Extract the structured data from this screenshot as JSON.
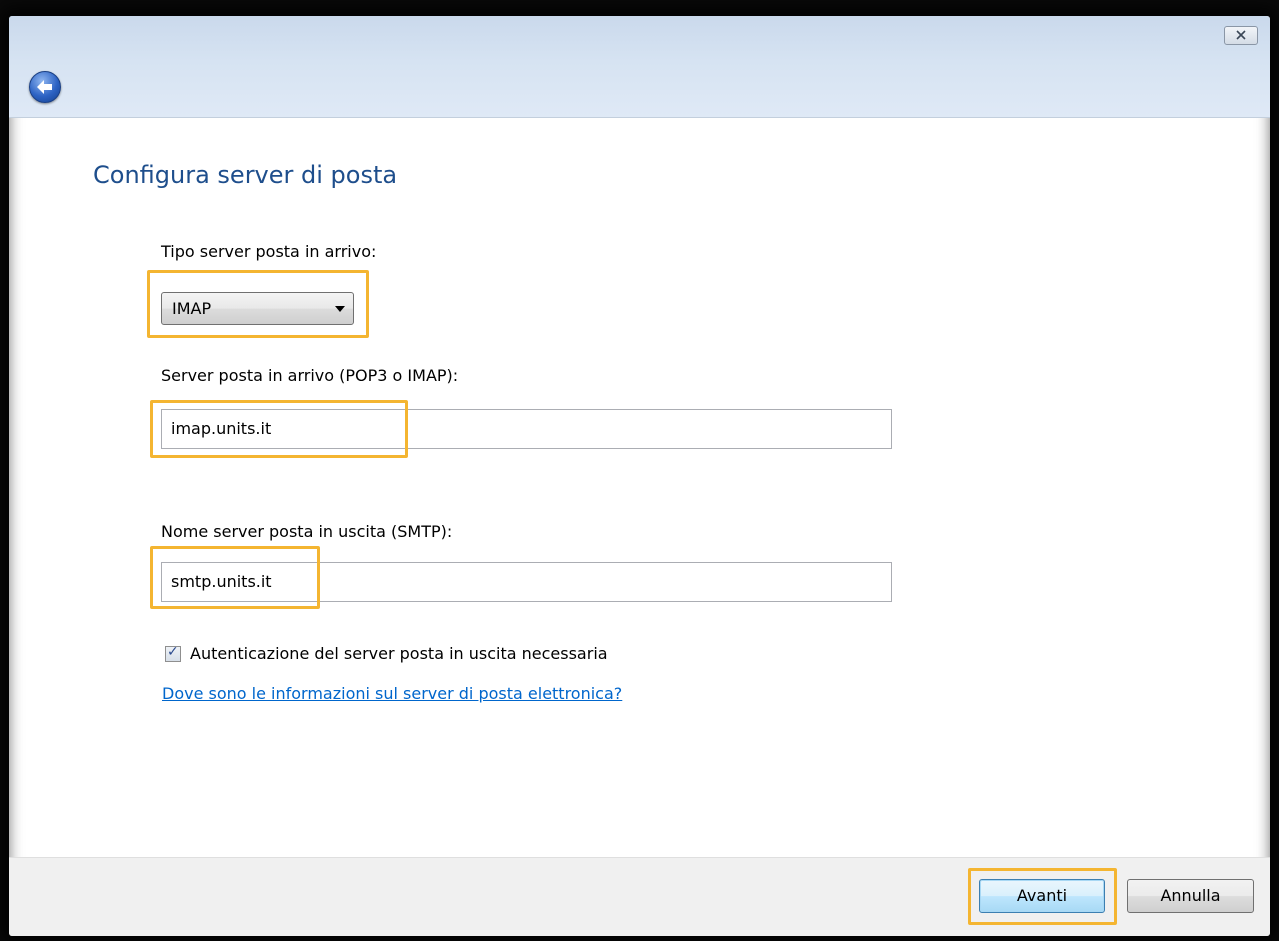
{
  "window": {
    "close_glyph": "✕",
    "back_glyph": "←"
  },
  "page": {
    "title": "Configura server di posta"
  },
  "form": {
    "incoming_type_label": "Tipo server posta in arrivo:",
    "incoming_type_value": "IMAP",
    "incoming_server_label": "Server posta in arrivo (POP3 o IMAP):",
    "incoming_server_value": "imap.units.it",
    "outgoing_server_label": "Nome server posta in uscita (SMTP):",
    "outgoing_server_value": "smtp.units.it",
    "auth_checkbox_label": "Autenticazione del server posta in uscita necessaria",
    "auth_checked": true,
    "help_link": "Dove sono le informazioni sul server di posta elettronica?"
  },
  "footer": {
    "next_label": "Avanti",
    "cancel_label": "Annulla"
  },
  "colors": {
    "highlight": "#f4b531",
    "title": "#1e4e8c",
    "link": "#0066cc"
  }
}
